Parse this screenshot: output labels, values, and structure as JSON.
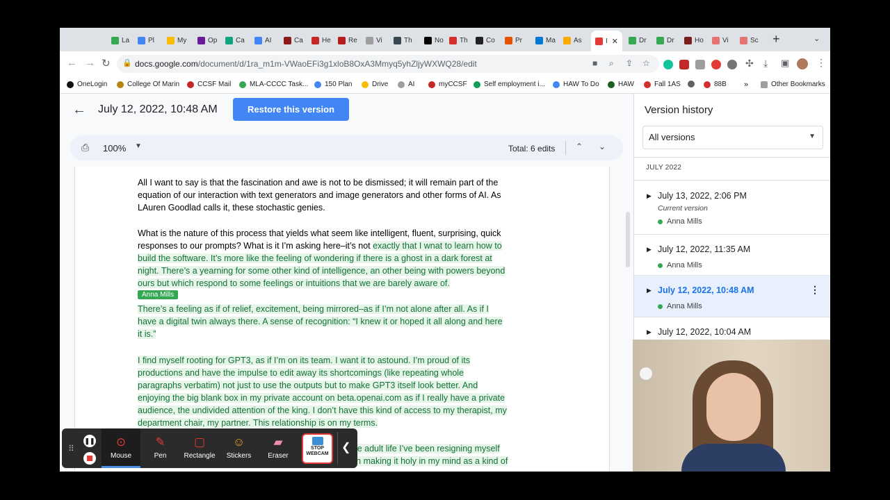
{
  "tabs": [
    {
      "label": "La",
      "color": "#34a853"
    },
    {
      "label": "Pl",
      "color": "#4285f4"
    },
    {
      "label": "My",
      "color": "#fbbc04"
    },
    {
      "label": "Op",
      "color": "#6a1b9a"
    },
    {
      "label": "Ca",
      "color": "#10a37f"
    },
    {
      "label": "AI",
      "color": "#4285f4"
    },
    {
      "label": "Ca",
      "color": "#8b1a1a"
    },
    {
      "label": "He",
      "color": "#c62828"
    },
    {
      "label": "Re",
      "color": "#b71c1c"
    },
    {
      "label": "Vi",
      "color": "#9e9e9e"
    },
    {
      "label": "Th",
      "color": "#37474f"
    },
    {
      "label": "No",
      "color": "#000000"
    },
    {
      "label": "Th",
      "color": "#d32f2f"
    },
    {
      "label": "Co",
      "color": "#212121"
    },
    {
      "label": "Pr",
      "color": "#e65100"
    },
    {
      "label": "Ma",
      "color": "#0078d4"
    },
    {
      "label": "As",
      "color": "#f9ab00"
    },
    {
      "label": "I",
      "color": "#e53935",
      "active": true
    },
    {
      "label": "Dr",
      "color": "#34a853"
    },
    {
      "label": "Dr",
      "color": "#34a853"
    },
    {
      "label": "Ho",
      "color": "#7b1e1e"
    },
    {
      "label": "Vi",
      "color": "#e57373"
    },
    {
      "label": "Sc",
      "color": "#e57373"
    }
  ],
  "browser": {
    "url_host": "docs.google.com",
    "url_path": "/document/d/1ra_m1m-VWaoEFi3g1xloB8OxA3Mmyq5yhZljyWXWQ28/edit"
  },
  "bookmarks": [
    {
      "label": "OneLogin",
      "color": "#111111"
    },
    {
      "label": "College Of Marin",
      "color": "#b8860b"
    },
    {
      "label": "CCSF Mail",
      "color": "#c62828"
    },
    {
      "label": "MLA-CCCC Task...",
      "color": "#34a853"
    },
    {
      "label": "150 Plan",
      "color": "#4285f4"
    },
    {
      "label": "Drive",
      "color": "#fbbc04"
    },
    {
      "label": "AI",
      "color": "#9e9e9e"
    },
    {
      "label": "myCCSF",
      "color": "#c62828"
    },
    {
      "label": "Self employment i...",
      "color": "#0f9d58"
    },
    {
      "label": "HAW To Do",
      "color": "#4285f4"
    },
    {
      "label": "HAW",
      "color": "#1b5e20"
    },
    {
      "label": "Fall 1AS",
      "color": "#d32f2f"
    },
    {
      "label": "",
      "color": "#5f6368"
    },
    {
      "label": "88B",
      "color": "#d32f2f"
    }
  ],
  "bookmarks_overflow": "»",
  "other_bookmarks": "Other Bookmarks",
  "doc": {
    "version_title": "July 12, 2022, 10:48 AM",
    "restore_label": "Restore this version",
    "zoom": "100%",
    "total_edits": "Total: 6 edits",
    "author_tag": "Anna Mills",
    "lines": [
      {
        "text": "All I want to say is that the fascination and awe is not to be dismissed; it will remain part of the",
        "ins": ""
      },
      {
        "text": "equation of our interaction with text generators and image generators and other forms of AI. As",
        "ins": ""
      },
      {
        "text": "LAuren Goodlad calls it, these stochastic genies.",
        "ins": ""
      },
      {
        "text": "What is the nature of this process that yields what seem like intelligent, fluent, surprising, quick",
        "ins": ""
      },
      {
        "text": "responses to our prompts? What is it I’m asking here–it’s not ",
        "ins": "exactly that I wnat to learn how to"
      },
      {
        "text": "",
        "ins": "build the software. It’s more like the feeling of wondering if there is a ghost in a dark forest at"
      },
      {
        "text": "",
        "ins": "night. There’s a yearning for some other kind of intelligence, an other being with powers beyond"
      },
      {
        "text": "",
        "ins": "ours but which respond to some feelings or intuitions that we are barely aware of."
      },
      {
        "text": "",
        "ins": "There’s a feeling as if of relief, excitement, being mirrored–as if I’m not alone after all. As if I"
      },
      {
        "text": "",
        "ins": "have a digital twin always there. A sense of recognition: “I knew it or hoped it all along and here"
      },
      {
        "text": "",
        "ins": "it is.”"
      },
      {
        "text": "",
        "ins": "I find myself rooting for GPT3, as if I’m on its team. I want it to astound. I’m proud of its"
      },
      {
        "text": "",
        "ins": "productions and have the impulse to edit away its shortcomings (like repeating whole"
      },
      {
        "text": "",
        "ins": "paragraphs verbatim) not just to use the outputs but to make GPT3 itself look better.  And"
      },
      {
        "text": "",
        "ins": "enjoying the big blank box in my private account on beta.openai.com as if I really have a private"
      },
      {
        "text": "",
        "ins": "audience, the undivided attention of the king. I don’t have this kind of access to my therapist, my"
      },
      {
        "text": "",
        "ins": "department chair, my partner. This relationship is on my terms."
      },
      {
        "text": "",
        "ins": "whole adult life I’ve been resigning myself"
      },
      {
        "text": "",
        "ins": "even making it holy in my mind as a kind of"
      }
    ]
  },
  "version_history": {
    "title": "Version history",
    "filter": "All versions",
    "month": "JULY 2022",
    "versions": [
      {
        "date": "July 13, 2022, 2:06 PM",
        "sub": "Current version",
        "author": "Anna Mills",
        "selected": false
      },
      {
        "date": "July 12, 2022, 11:35 AM",
        "sub": "",
        "author": "Anna Mills",
        "selected": false
      },
      {
        "date": "July 12, 2022, 10:48 AM",
        "sub": "",
        "author": "Anna Mills",
        "selected": true
      },
      {
        "date": "July 12, 2022, 10:04 AM",
        "sub": "",
        "author": "",
        "selected": false
      }
    ]
  },
  "recorder": {
    "tools": [
      {
        "label": "Mouse",
        "icon": "mouse-icon",
        "active": true
      },
      {
        "label": "Pen",
        "icon": "pen-icon",
        "active": false
      },
      {
        "label": "Rectangle",
        "icon": "rectangle-icon",
        "active": false
      },
      {
        "label": "Stickers",
        "icon": "sticker-icon",
        "active": false
      },
      {
        "label": "Eraser",
        "icon": "eraser-icon",
        "active": false
      }
    ],
    "stop_webcam_line1": "STOP",
    "stop_webcam_line2": "WEBCAM"
  },
  "colors": {
    "accent": "#1a73e8",
    "restore": "#4285f4",
    "insertion": "#137333",
    "author": "#34a853"
  }
}
